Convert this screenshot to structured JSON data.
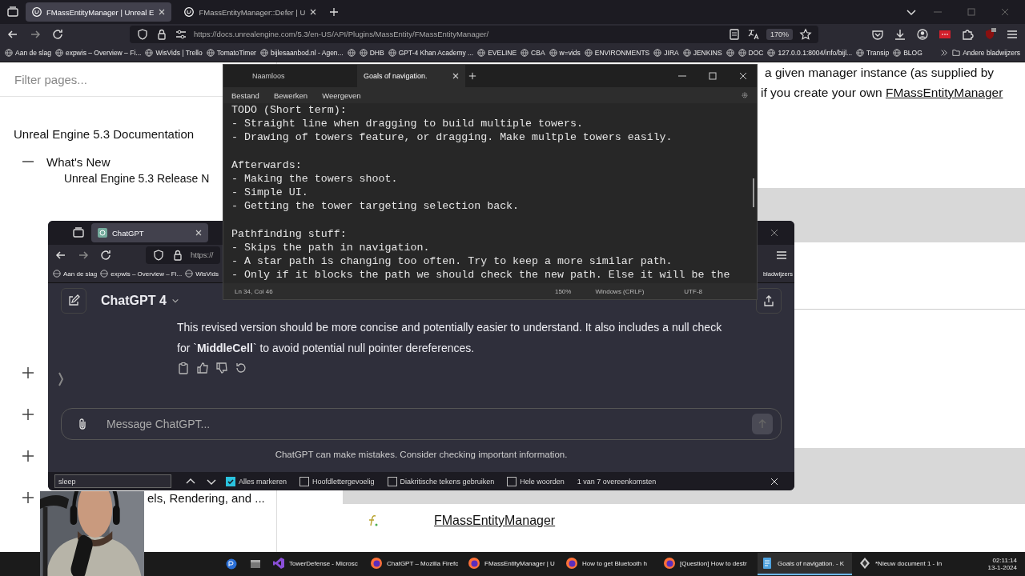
{
  "browser": {
    "tabs": [
      {
        "title": "FMassEntityManager | Unreal E",
        "selected": true
      },
      {
        "title": "FMassEntityManager::Defer | U",
        "selected": false
      }
    ],
    "url": "https://docs.unrealengine.com/5.3/en-US/API/Plugins/MassEntity/FMassEntityManager/",
    "zoom": "170%",
    "bookmarks": [
      {
        "kind": "link",
        "label": "Aan de slag"
      },
      {
        "kind": "link",
        "label": "expwis – Overview – Fi..."
      },
      {
        "kind": "link",
        "label": "WisVids | Trello"
      },
      {
        "kind": "link",
        "label": "TomatoTimer"
      },
      {
        "kind": "link",
        "label": "bijlesaanbod.nl - Agen..."
      },
      {
        "kind": "icon"
      },
      {
        "kind": "link",
        "label": "DHB"
      },
      {
        "kind": "link",
        "label": "GPT-4 Khan Academy ..."
      },
      {
        "kind": "link",
        "label": "EVELINE"
      },
      {
        "kind": "link",
        "label": "CBA"
      },
      {
        "kind": "link",
        "label": "w=vids"
      },
      {
        "kind": "link",
        "label": "ENVIRONMENTS"
      },
      {
        "kind": "link",
        "label": "JIRA"
      },
      {
        "kind": "link",
        "label": "JENKINS"
      },
      {
        "kind": "icon"
      },
      {
        "kind": "link",
        "label": "DOC"
      },
      {
        "kind": "link",
        "label": "127.0.0.1:8004/info/bijl..."
      },
      {
        "kind": "link",
        "label": "Transip"
      },
      {
        "kind": "link",
        "label": "BLOG"
      }
    ],
    "other_bookmarks": "Andere bladwijzers"
  },
  "docs": {
    "filter": {
      "placeholder": "Filter pages..."
    },
    "title": "Unreal Engine 5.3 Documentation",
    "tree": [
      {
        "label": "What's New",
        "expanded": true,
        "children": [
          {
            "label": "Unreal Engine 5.3 Release N"
          }
        ]
      },
      {
        "expanded": false
      },
      {
        "expanded": false
      },
      {
        "expanded": false
      },
      {
        "label": "els, Rendering, and ...",
        "expanded": false
      }
    ],
    "content_lines": [
      "a given manager instance (as supplied by",
      "if you create your own "
    ],
    "content_link": "FMassEntityManager",
    "member_link": "FMassEntityManager"
  },
  "notepad": {
    "tabs": [
      {
        "title": "Naamloos",
        "selected": false
      },
      {
        "title": "Goals of navigation.",
        "selected": true
      }
    ],
    "menu": [
      "Bestand",
      "Bewerken",
      "Weergeven"
    ],
    "paragraphs": [
      [
        "TODO (Short term):",
        "- Straight line when dragging to build multiple towers.",
        "- Drawing of towers feature, or dragging. Make multple towers easily."
      ],
      [
        "Afterwards:",
        "- Making the towers shoot.",
        "- Simple UI.",
        "- Getting the tower targeting selection back."
      ],
      [
        "Pathfinding stuff:",
        "- Skips the path in navigation.",
        "- A star path is changing too often. Try to keep a more similar path.",
        "- Only if it blocks the path we should check the new path. Else it will be the"
      ]
    ],
    "status": [
      "Ln 34, Col 46",
      "150%",
      "Windows (CRLF)",
      "UTF-8"
    ]
  },
  "chatgpt": {
    "tab": "ChatGPT",
    "url": "https://",
    "bookmarks": [
      "Aan de slag",
      "expwis – Overview – Fi...",
      "WisVids"
    ],
    "other_bookmarks": "bladwijzers",
    "model": "ChatGPT 4",
    "message": "This revised version should be more concise and potentially easier to understand. It also includes a null check for `**MiddleCell**` to avoid potential null pointer dereferences.",
    "input": {
      "placeholder": "Message ChatGPT..."
    },
    "disclaimer": "ChatGPT can make mistakes. Consider checking important information.",
    "find": {
      "value": "sleep",
      "options": [
        {
          "label": "Alles markeren",
          "checked": true
        },
        {
          "label": "Hoofdlettergevoelig",
          "checked": false
        },
        {
          "label": "Diakritische tekens gebruiken",
          "checked": false
        },
        {
          "label": "Hele woorden",
          "checked": false
        }
      ],
      "result": "1 van 7 overeenkomsten"
    }
  },
  "taskbar": {
    "items": [
      {
        "kind": "vs",
        "label": "TowerDefense - Microsc",
        "selected": false
      },
      {
        "kind": "firefox",
        "label": "ChatGPT – Mozilla Firefc",
        "selected": false
      },
      {
        "kind": "firefox",
        "label": "FMassEntityManager | U",
        "selected": false
      },
      {
        "kind": "firefox",
        "label": "How to get Bluetooth h",
        "selected": false
      },
      {
        "kind": "firefox",
        "label": "[Question] How to destr",
        "selected": false
      },
      {
        "kind": "notepad",
        "label": "Goals of navigation. - K",
        "selected": true
      },
      {
        "kind": "editor",
        "label": "*Nieuw document 1 - In",
        "selected": false
      }
    ],
    "time": "02:11:14",
    "date": "13-1-2024"
  }
}
